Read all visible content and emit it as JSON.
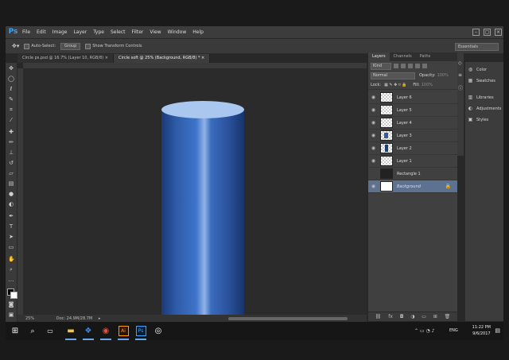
{
  "app": {
    "logo": "Ps",
    "menu": [
      "File",
      "Edit",
      "Image",
      "Layer",
      "Type",
      "Select",
      "Filter",
      "View",
      "Window",
      "Help"
    ],
    "window_controls": [
      "–",
      "▢",
      "×"
    ]
  },
  "options_bar": {
    "auto_select_label": "Auto-Select:",
    "auto_select_value": "Group",
    "show_transform_label": "Show Transform Controls",
    "workspace": "Essentials"
  },
  "doc_tabs": [
    {
      "label": "Circle ps.psd @ 16.7% (Layer 10, RGB/8) ×"
    },
    {
      "label": "Circle soft @ 25% (Background, RGB/8) *  ×"
    }
  ],
  "status": {
    "zoom": "25%",
    "doc_size": "Doc: 24.9M/28.7M"
  },
  "layers_panel": {
    "tabs": [
      "Layers",
      "Channels",
      "Paths"
    ],
    "filter_kind": "Kind",
    "blend_mode": "Normal",
    "opacity_label": "Opacity:",
    "opacity_value": "100%",
    "lock_label": "Lock:",
    "fill_label": "Fill:",
    "fill_value": "100%",
    "layers": [
      {
        "name": "Layer 6"
      },
      {
        "name": "Layer 5"
      },
      {
        "name": "Layer 4"
      },
      {
        "name": "Layer 3"
      },
      {
        "name": "Layer 2"
      },
      {
        "name": "Layer 1"
      },
      {
        "name": "Rectangle 1"
      },
      {
        "name": "Background",
        "selected": true,
        "locked": true
      }
    ],
    "footer_icons": [
      "link-icon",
      "fx-icon",
      "mask-icon",
      "adjustment-icon",
      "folder-icon",
      "new-layer-icon",
      "trash-icon"
    ]
  },
  "right_dock": [
    {
      "label": "Color",
      "icon": "color-icon"
    },
    {
      "label": "Swatches",
      "icon": "swatches-icon"
    },
    {
      "label": "Libraries",
      "icon": "libraries-icon"
    },
    {
      "label": "Adjustments",
      "icon": "adjustments-icon"
    },
    {
      "label": "Styles",
      "icon": "styles-icon"
    }
  ],
  "taskbar": {
    "time": "11:22 PM",
    "date": "9/6/2017",
    "lang": "ENG"
  },
  "colors": {
    "cylinder_top": "#a9c7ef",
    "cylinder_body": "#2f5ba8",
    "accent": "#31a8ff",
    "selected_layer": "#5d7290"
  }
}
